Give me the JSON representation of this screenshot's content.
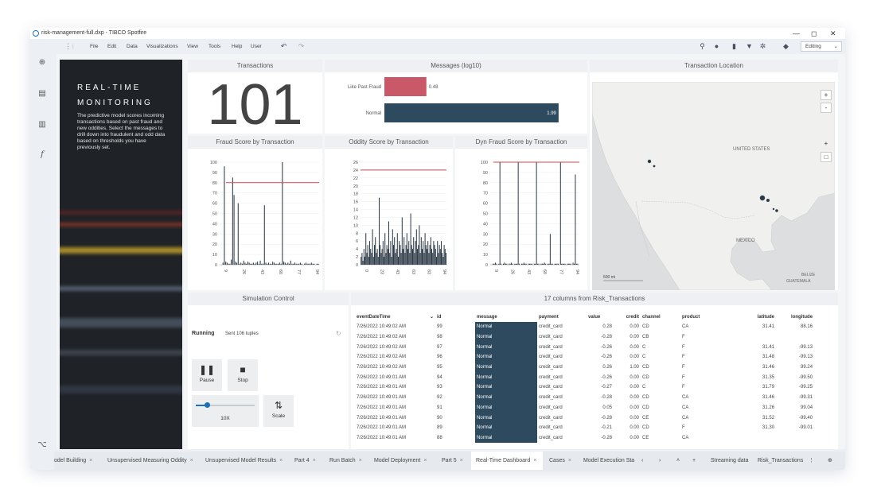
{
  "window": {
    "title": "risk-management-full.dxp - TIBCO Spotfire",
    "controls": [
      "—",
      "◻",
      "✕"
    ]
  },
  "menu": {
    "items": [
      "File",
      "Edit",
      "Data",
      "Visualizations",
      "View",
      "Tools",
      "Help",
      "User"
    ],
    "mode": "Editing"
  },
  "hero": {
    "title": "REAL-TIME\nMONITORING",
    "description": "The predictive model scores incoming transactions based on past fraud and new oddities. Select the messages to drill down into fraudulent and odd data based on thresholds you have previously set."
  },
  "transactions": {
    "title": "Transactions",
    "value": "101"
  },
  "messages": {
    "title": "Messages (log10)",
    "chart_data": {
      "type": "bar",
      "categories": [
        "Like Past Fraud",
        "Normal"
      ],
      "values": [
        0.48,
        1.99
      ],
      "labels": [
        "0.48",
        "1.99"
      ],
      "colors": [
        "#c95968",
        "#2d4a5e"
      ],
      "xlim": [
        0,
        2.1
      ]
    }
  },
  "location": {
    "title": "Transaction Location",
    "labels": [
      "UNITED STATES",
      "MEXICO",
      "BELIZE",
      "GUATEMALA"
    ],
    "scale": "500 mi",
    "zoom_in": "+",
    "zoom_out": "-"
  },
  "fraud_chart": {
    "title": "Fraud Score by Transaction",
    "chart_data": {
      "type": "bar",
      "ylim": [
        0,
        100
      ],
      "yticks": [
        "0",
        "10",
        "20",
        "30",
        "40",
        "50",
        "60",
        "70",
        "80",
        "90",
        "100"
      ],
      "xticks": [
        "9",
        "26",
        "43",
        "60",
        "77",
        "94"
      ],
      "threshold": 80,
      "values": [
        0,
        0,
        2,
        96,
        3,
        2,
        1,
        1,
        5,
        85,
        68,
        3,
        2,
        60,
        1,
        2,
        1,
        4,
        2,
        1,
        3,
        2,
        1,
        1,
        2,
        1,
        2,
        3,
        1,
        4,
        1,
        1,
        58,
        2,
        1,
        2,
        1,
        1,
        3,
        2,
        1,
        1,
        1,
        2,
        1,
        100,
        3,
        2,
        1,
        2,
        1,
        4,
        1,
        1,
        2,
        1,
        1,
        1,
        2,
        1,
        0,
        1,
        2,
        1,
        1,
        1,
        2,
        1,
        1,
        0,
        1,
        1
      ]
    }
  },
  "oddity_chart": {
    "title": "Oddity Score by Transaction",
    "chart_data": {
      "type": "bar",
      "ylim": [
        0,
        26
      ],
      "yticks": [
        "0",
        "2",
        "4",
        "6",
        "8",
        "10",
        "12",
        "14",
        "16",
        "18",
        "20",
        "22",
        "24",
        "26"
      ],
      "xticks": [
        "0",
        "23",
        "43",
        "63",
        "83",
        "94"
      ],
      "threshold": 24,
      "values": [
        2,
        3,
        1,
        4,
        2,
        8,
        3,
        5,
        2,
        6,
        4,
        3,
        9,
        2,
        5,
        7,
        3,
        4,
        2,
        17,
        5,
        3,
        4,
        6,
        2,
        8,
        3,
        5,
        4,
        11,
        3,
        6,
        2,
        9,
        5,
        7,
        3,
        4,
        8,
        2,
        6,
        5,
        3,
        12,
        4,
        7,
        3,
        5,
        8,
        4,
        6,
        3,
        13,
        5,
        4,
        7,
        3,
        6,
        9,
        4,
        5,
        10,
        3,
        7,
        4,
        6,
        3,
        8,
        5,
        4,
        6,
        3,
        5,
        7,
        4,
        3,
        6,
        5,
        4,
        2,
        6,
        3,
        5,
        4,
        6,
        3,
        2,
        5,
        4,
        3
      ]
    }
  },
  "dyn_chart": {
    "title": "Dyn Fraud Score by Transaction",
    "chart_data": {
      "type": "bar",
      "ylim": [
        0,
        100
      ],
      "yticks": [
        "0",
        "10",
        "20",
        "30",
        "40",
        "50",
        "60",
        "70",
        "80",
        "90",
        "100"
      ],
      "xticks": [
        "9",
        "26",
        "43",
        "60",
        "77",
        "94"
      ],
      "threshold": 100,
      "values": [
        0,
        0,
        1,
        1,
        2,
        1,
        0,
        1,
        100,
        1,
        0,
        1,
        2,
        1,
        1,
        0,
        1,
        1,
        2,
        1,
        0,
        1,
        1,
        1,
        100,
        1,
        0,
        1,
        1,
        2,
        1,
        1,
        0,
        1,
        1,
        1,
        1,
        0,
        1,
        1,
        100,
        1,
        1,
        0,
        1,
        1,
        1,
        2,
        1,
        0,
        1,
        1,
        30,
        1,
        1,
        0,
        1,
        1,
        1,
        1,
        0,
        100,
        1,
        1,
        1,
        1,
        0,
        1,
        1,
        1,
        1,
        0,
        2,
        1,
        88,
        1,
        1,
        0
      ]
    }
  },
  "simulation": {
    "title": "Simulation Control",
    "status": "Running",
    "detail": "Sent 106 tuples",
    "pause": "Pause",
    "stop": "Stop",
    "speed": "10X",
    "speed_level": 0.2,
    "scale": "Scale"
  },
  "table": {
    "title": "17 columns from Risk_Transactions",
    "columns": [
      "eventDateTime",
      "id",
      "message",
      "payment",
      "value",
      "credit",
      "channel",
      "product",
      "latitude",
      "longitude"
    ],
    "rows": [
      [
        "7/26/2022 10:49:02 AM",
        "99",
        "Normal",
        "credit_card",
        "0.28",
        "0.00",
        "CD",
        "CA",
        "31.41",
        "88.16"
      ],
      [
        "7/26/2022 10:49:02 AM",
        "98",
        "Normal",
        "credit_card",
        "-0.28",
        "0.00",
        "CB",
        "F",
        "",
        ""
      ],
      [
        "7/26/2022 10:49:02 AM",
        "97",
        "Normal",
        "credit_card",
        "-0.26",
        "0.00",
        "C",
        "F",
        "31.41",
        "-99.13"
      ],
      [
        "7/26/2022 10:49:02 AM",
        "96",
        "Normal",
        "credit_card",
        "-0.26",
        "0.00",
        "C",
        "F",
        "31.48",
        "-99.13"
      ],
      [
        "7/26/2022 10:49:02 AM",
        "95",
        "Normal",
        "credit_card",
        "0.26",
        "1.00",
        "CD",
        "F",
        "31.46",
        "99.24"
      ],
      [
        "7/26/2022 10:49:01 AM",
        "94",
        "Normal",
        "credit_card",
        "-0.26",
        "0.00",
        "CD",
        "F",
        "31.35",
        "-99.50"
      ],
      [
        "7/26/2022 10:49:01 AM",
        "93",
        "Normal",
        "credit_card",
        "-0.27",
        "0.00",
        "C",
        "F",
        "31.79",
        "-99.25"
      ],
      [
        "7/26/2022 10:49:01 AM",
        "92",
        "Normal",
        "credit_card",
        "-0.28",
        "0.00",
        "CD",
        "CA",
        "31.46",
        "-99.31"
      ],
      [
        "7/26/2022 10:49:01 AM",
        "91",
        "Normal",
        "credit_card",
        "0.05",
        "0.00",
        "CD",
        "CA",
        "31.26",
        "99.04"
      ],
      [
        "7/26/2022 10:49:01 AM",
        "90",
        "Normal",
        "credit_card",
        "-0.28",
        "0.00",
        "CE",
        "CA",
        "31.52",
        "-99.40"
      ],
      [
        "7/26/2022 10:49:01 AM",
        "89",
        "Normal",
        "credit_card",
        "-0.21",
        "0.00",
        "CD",
        "F",
        "31.30",
        "-99.01"
      ],
      [
        "7/26/2022 10:49:01 AM",
        "88",
        "Normal",
        "credit_card",
        "-0.28",
        "0.00",
        "CE",
        "CA",
        "",
        ""
      ]
    ]
  },
  "tabs": {
    "items": [
      "odel Building",
      "Unsupervised Measuring Oddity",
      "Unsupervised Model Results",
      "Part 4",
      "Run Batch",
      "Model Deployment",
      "Part 5",
      "Real-Time Dashboard",
      "Cases",
      "Model Execution Sta"
    ],
    "active_index": 7,
    "right": [
      "Streaming data",
      "Risk_Transactions"
    ]
  }
}
